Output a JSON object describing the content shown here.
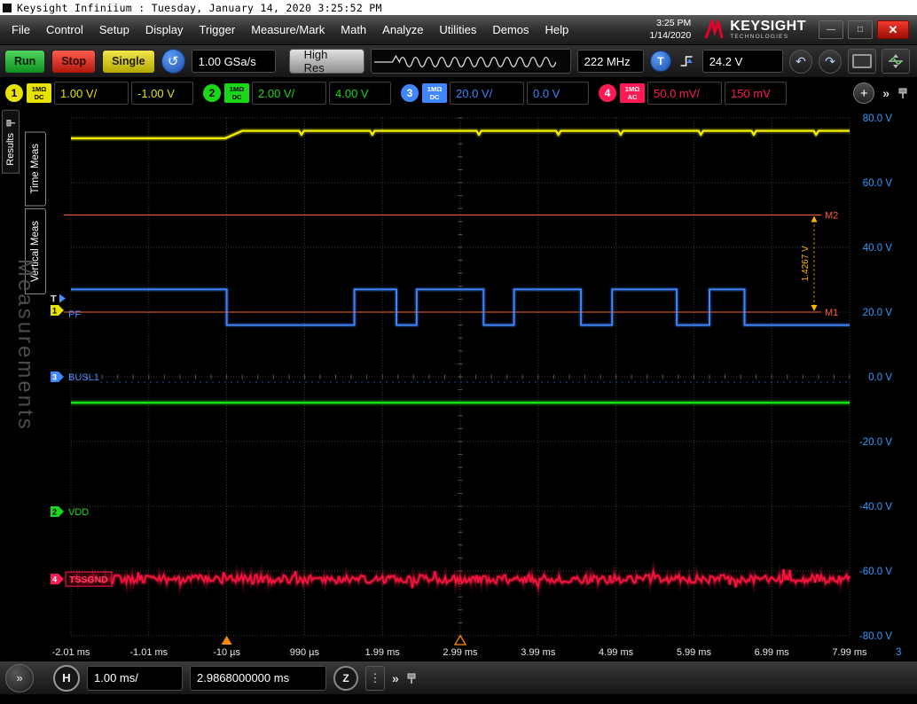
{
  "title_bar": {
    "title": "Keysight Infiniium : Tuesday, January 14, 2020 3:25:52 PM"
  },
  "menu_bar": {
    "items": [
      "File",
      "Control",
      "Setup",
      "Display",
      "Trigger",
      "Measure/Mark",
      "Math",
      "Analyze",
      "Utilities",
      "Demos",
      "Help"
    ],
    "clock": {
      "time": "3:25 PM",
      "date": "1/14/2020"
    },
    "brand": {
      "name": "KEYSIGHT",
      "sub": "TECHNOLOGIES"
    }
  },
  "toolbar": {
    "run": "Run",
    "stop": "Stop",
    "single": "Single",
    "sample_rate": "1.00 GSa/s",
    "acquisition_mode": "High Res",
    "bandwidth": "222 MHz",
    "trigger_label": "T",
    "trigger_level": "24.2 V"
  },
  "channel_bar": {
    "channels": [
      {
        "number": "1",
        "impedance": "1MΩ",
        "coupling": "DC",
        "scale": "1.00 V/",
        "offset": "-1.00 V",
        "color": "#e8e200",
        "text": "#000"
      },
      {
        "number": "2",
        "impedance": "1MΩ",
        "coupling": "DC",
        "scale": "2.00 V/",
        "offset": "4.00 V",
        "color": "#18d818",
        "text": "#000"
      },
      {
        "number": "3",
        "impedance": "1MΩ",
        "coupling": "DC",
        "scale": "20.0 V/",
        "offset": "0.0 V",
        "color": "#3f86ff",
        "text": "#fff"
      },
      {
        "number": "4",
        "impedance": "1MΩ",
        "coupling": "AC",
        "scale": "50.0 mV/",
        "offset": "150 mV",
        "color": "#ff1a55",
        "text": "#fff"
      }
    ]
  },
  "sidebar": {
    "results_tab": "Results",
    "tabs": [
      "Time Meas",
      "Vertical Meas"
    ],
    "watermark": "Measurements"
  },
  "plot": {
    "y_axis_labels": [
      "80.0 V",
      "60.0 V",
      "40.0 V",
      "20.0 V",
      "0.0 V",
      "-20.0 V",
      "-40.0 V",
      "-60.0 V",
      "-80.0 V"
    ],
    "x_axis_labels": [
      "-2.01 ms",
      "-1.01 ms",
      "-10 µs",
      "990 µs",
      "1.99 ms",
      "2.99 ms",
      "3.99 ms",
      "4.99 ms",
      "5.99 ms",
      "6.99 ms",
      "7.99 ms"
    ],
    "axis_channel": "3",
    "markers": {
      "m1_label": "M1",
      "m2_label": "M2",
      "delta_label": "1.4267 V"
    },
    "trace_labels": {
      "pf": "PF",
      "busl1": "BUSL1",
      "vdd": "VDD",
      "tssgnd": "TSSGND"
    },
    "trigger_marker": "T"
  },
  "bottom_bar": {
    "horizontal_label": "H",
    "timebase": "1.00 ms/",
    "delay": "2.9868000000 ms",
    "zoom_label": "Z"
  },
  "icons": {
    "clear_display": "↺",
    "undo": "↶",
    "redo": "↷",
    "expand": "»",
    "add_channel": "+",
    "more_dots": "⋮",
    "minimize": "—",
    "maximize": "□",
    "close": "✕"
  },
  "chart_data": {
    "type": "line",
    "x_unit": "ms",
    "y_unit": "V",
    "x_range": [
      -2.01,
      7.99
    ],
    "y_range": [
      -80,
      80
    ],
    "x_tick_step_ms": 1.0,
    "y_tick_step_v": 20,
    "grid": "dotted",
    "series": [
      {
        "name": "ch1-vin",
        "color": "#f2ee00",
        "width": 2.4,
        "type": "points",
        "points": [
          [
            -2.01,
            73.7
          ],
          [
            -0.03,
            73.7
          ],
          [
            0.19,
            76.0
          ],
          [
            7.99,
            76.0
          ]
        ],
        "glitches": {
          "times": [
            0.95,
            1.86,
            3.23,
            4.25,
            5.05,
            6.08,
            6.76,
            7.56
          ],
          "depth": 1.2
        }
      },
      {
        "name": "ch3-pf",
        "color": "#3f86ff",
        "width": 2.0,
        "type": "square",
        "high": 27,
        "low": 16,
        "start": "high",
        "transitions": [
          -0.01,
          1.63,
          2.17,
          2.43,
          3.29,
          3.68,
          4.54,
          4.94,
          5.77,
          6.19,
          6.64
        ]
      },
      {
        "name": "ch2-vdd",
        "color": "#12e012",
        "width": 2.6,
        "type": "points",
        "points": [
          [
            -2.01,
            -8.0
          ],
          [
            7.99,
            -8.0
          ]
        ]
      },
      {
        "name": "ch4-tssgnd",
        "color": "#ff1440",
        "width": 1.8,
        "type": "noise",
        "center": -62.5,
        "amplitude": 1.3,
        "spike_amplitude": 2.6
      }
    ],
    "marker_lines": [
      {
        "label": "M1",
        "value_v": 20.0
      },
      {
        "label": "M2",
        "value_v": 50.0
      }
    ],
    "marker_delta_readout": "1.4267 V",
    "trigger": {
      "source_level_v": 24.2,
      "time_ms": -0.01
    },
    "reference_time_ms": 2.99
  }
}
